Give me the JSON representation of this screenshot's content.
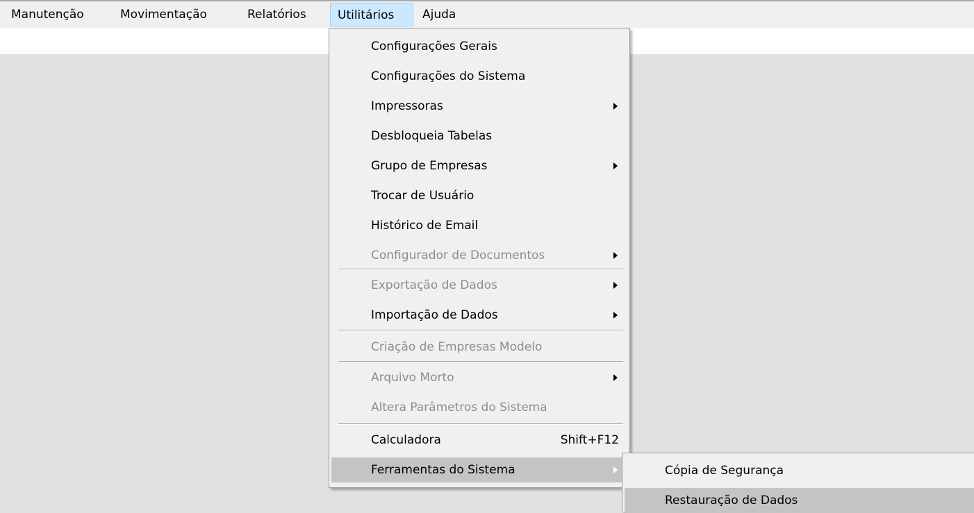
{
  "menubar": {
    "items": [
      {
        "label": "Manutenção"
      },
      {
        "label": "Movimentação"
      },
      {
        "label": "Relatórios"
      },
      {
        "label": "Utilitários"
      },
      {
        "label": "Ajuda"
      }
    ]
  },
  "utilitarios_menu": {
    "items": [
      {
        "label": "Configurações Gerais",
        "enabled": true,
        "submenu": false
      },
      {
        "label": "Configurações do Sistema",
        "enabled": true,
        "submenu": false
      },
      {
        "label": "Impressoras",
        "enabled": true,
        "submenu": true
      },
      {
        "label": "Desbloqueia Tabelas",
        "enabled": true,
        "submenu": false
      },
      {
        "label": "Grupo de Empresas",
        "enabled": true,
        "submenu": true
      },
      {
        "label": "Trocar de Usuário",
        "enabled": true,
        "submenu": false
      },
      {
        "label": "Histórico de Email",
        "enabled": true,
        "submenu": false
      },
      {
        "label": "Configurador de Documentos",
        "enabled": false,
        "submenu": true
      },
      {
        "label": "Exportação de Dados",
        "enabled": false,
        "submenu": true
      },
      {
        "label": "Importação de Dados",
        "enabled": true,
        "submenu": true
      },
      {
        "label": "Criação de Empresas Modelo",
        "enabled": false,
        "submenu": false
      },
      {
        "label": "Arquivo Morto",
        "enabled": false,
        "submenu": true
      },
      {
        "label": "Altera Parâmetros do Sistema",
        "enabled": false,
        "submenu": false
      },
      {
        "label": "Calculadora",
        "shortcut": "Shift+F12",
        "enabled": true,
        "submenu": false
      },
      {
        "label": "Ferramentas do Sistema",
        "enabled": true,
        "submenu": true,
        "highlighted": true
      }
    ]
  },
  "ferramentas_submenu": {
    "items": [
      {
        "label": "Cópia de Segurança"
      },
      {
        "label": "Restauração de Dados",
        "highlighted": true
      }
    ]
  },
  "colors": {
    "background": "#e1e1e1",
    "menubar": "#f0f0f0",
    "active_menubar_item": "#cce8ff",
    "highlight": "#c4c4c4",
    "disabled_text": "#8d8d8d"
  }
}
